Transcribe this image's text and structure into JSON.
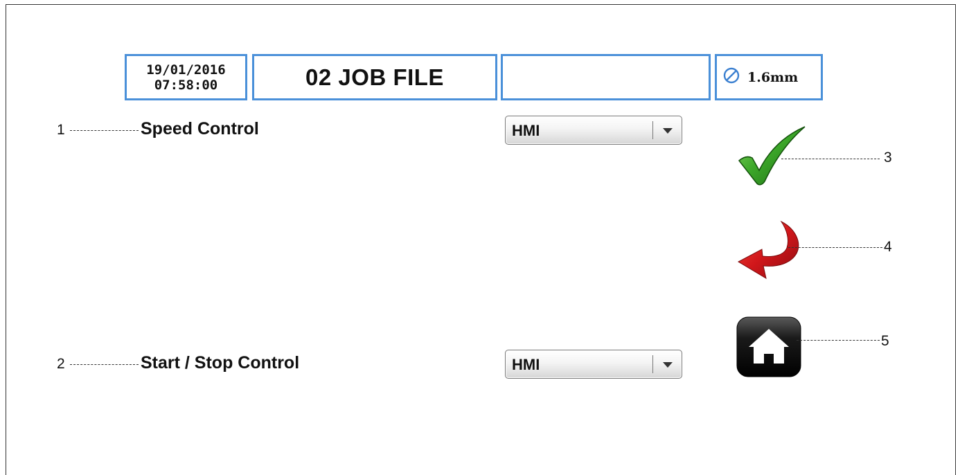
{
  "header": {
    "date": "19/01/2016",
    "time": "07:58:00",
    "title": "02 JOB FILE",
    "empty_field": "",
    "wire_diameter_icon": "diameter-icon",
    "wire_diameter": "1.6mm"
  },
  "settings": [
    {
      "callout": "1",
      "label": "Speed Control",
      "value": "HMI"
    },
    {
      "callout": "2",
      "label": "Start / Stop Control",
      "value": "HMI"
    }
  ],
  "actions": [
    {
      "callout": "3",
      "icon": "checkmark-icon",
      "color": "#2e8b1e"
    },
    {
      "callout": "4",
      "icon": "back-arrow-icon",
      "color": "#c0161a"
    },
    {
      "callout": "5",
      "icon": "home-icon",
      "color": "#111111"
    }
  ],
  "colors": {
    "box_border": "#4a90d9"
  }
}
